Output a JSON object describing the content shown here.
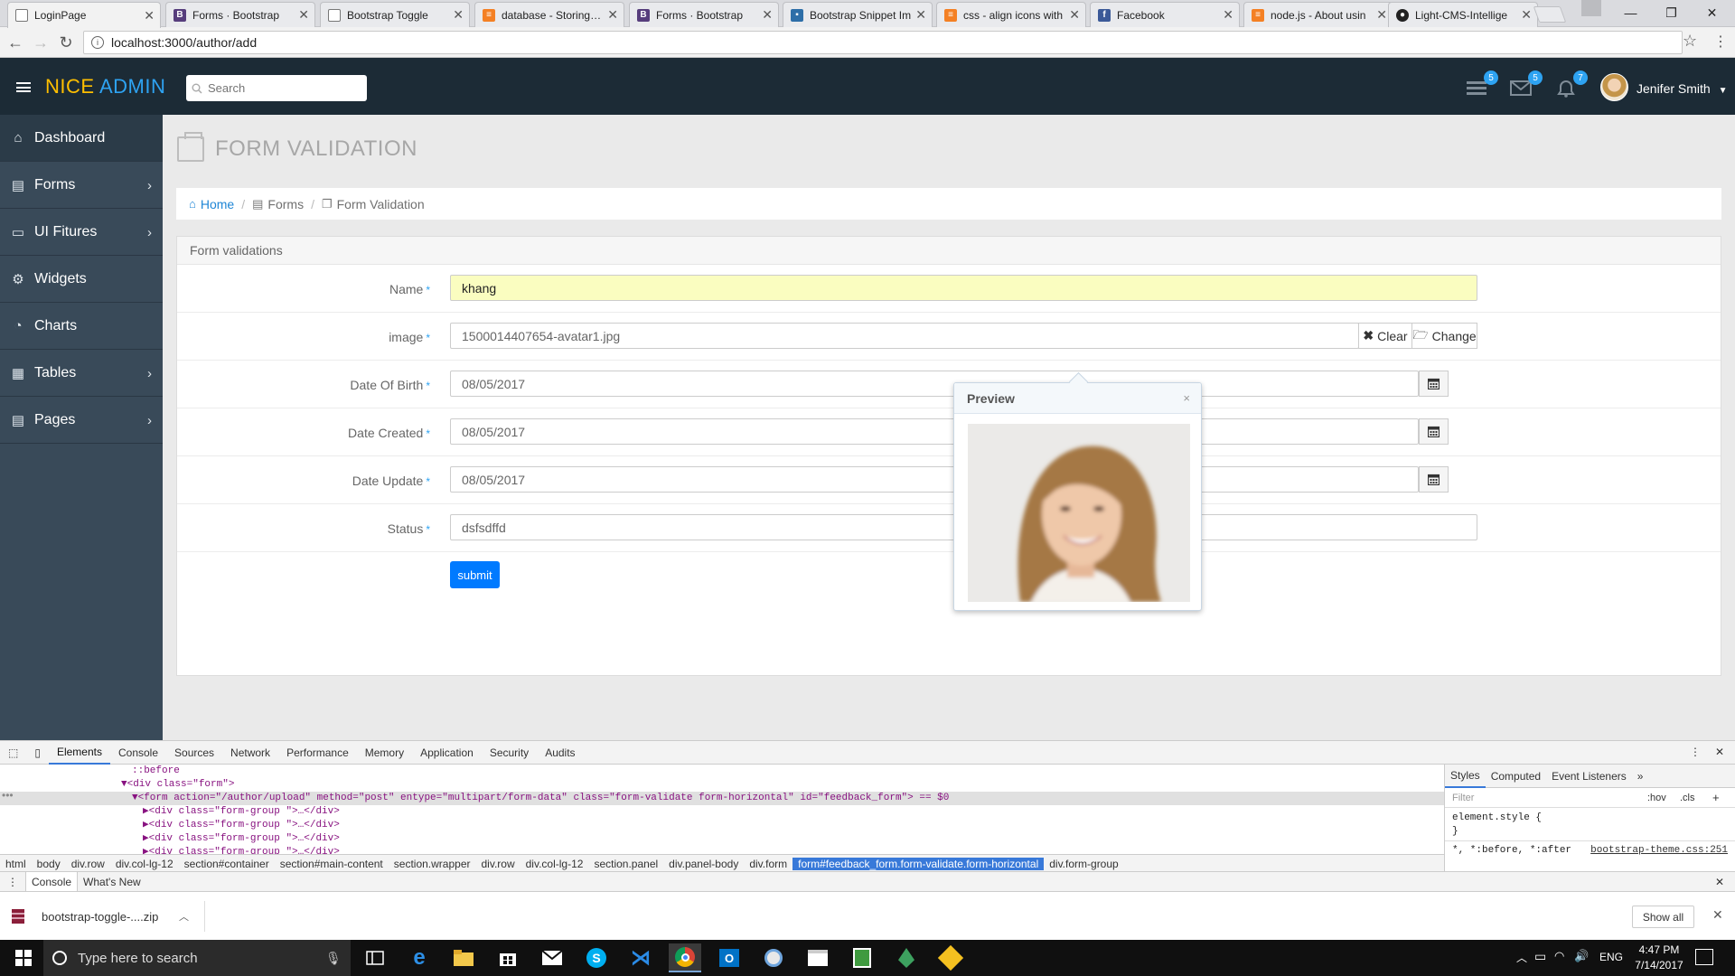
{
  "browser": {
    "tabs": [
      {
        "title": "LoginPage",
        "favicon": "page-icon",
        "active": true
      },
      {
        "title": "Forms · Bootstrap",
        "favicon": "bootstrap-icon"
      },
      {
        "title": "Bootstrap Toggle",
        "favicon": "page-icon"
      },
      {
        "title": "database - Storing im",
        "favicon": "stackoverflow-icon"
      },
      {
        "title": "Forms · Bootstrap",
        "favicon": "bootstrap-icon"
      },
      {
        "title": "Bootstrap Snippet Im",
        "favicon": "snippet-icon"
      },
      {
        "title": "css - align icons with",
        "favicon": "stackoverflow-icon"
      },
      {
        "title": "Facebook",
        "favicon": "facebook-icon"
      },
      {
        "title": "node.js - About usin",
        "favicon": "stackoverflow-icon"
      },
      {
        "title": "Light-CMS-Intellige",
        "favicon": "github-icon"
      }
    ],
    "url": "localhost:3000/author/add"
  },
  "app": {
    "brand_primary": "NICE",
    "brand_secondary": "ADMIN",
    "search_placeholder": "Search",
    "badges": {
      "tasks": "5",
      "mail": "5",
      "notifications": "7"
    },
    "user_name": "Jenifer Smith"
  },
  "sidebar": {
    "items": [
      {
        "label": "Dashboard",
        "icon": "home-icon",
        "has_submenu": false
      },
      {
        "label": "Forms",
        "icon": "document-icon",
        "has_submenu": true
      },
      {
        "label": "UI Fitures",
        "icon": "monitor-icon",
        "has_submenu": true
      },
      {
        "label": "Widgets",
        "icon": "cogs-icon",
        "has_submenu": false
      },
      {
        "label": "Charts",
        "icon": "pie-chart-icon",
        "has_submenu": false
      },
      {
        "label": "Tables",
        "icon": "table-icon",
        "has_submenu": true
      },
      {
        "label": "Pages",
        "icon": "pages-icon",
        "has_submenu": true
      }
    ]
  },
  "page": {
    "title": "FORM VALIDATION",
    "breadcrumb": [
      "Home",
      "Forms",
      "Form Validation"
    ]
  },
  "form": {
    "panel_title": "Form validations",
    "required_mark": "*",
    "fields": {
      "name": {
        "label": "Name",
        "value": "khang"
      },
      "image": {
        "label": "image",
        "value": "1500014407654-avatar1.jpg",
        "clear_label": "Clear",
        "change_label": "Change"
      },
      "dob": {
        "label": "Date Of Birth",
        "value": "08/05/2017"
      },
      "created": {
        "label": "Date Created",
        "value": "08/05/2017"
      },
      "updated": {
        "label": "Date Update",
        "value": "08/05/2017"
      },
      "status": {
        "label": "Status",
        "value": "dsfsdffd"
      }
    },
    "submit_label": "submit",
    "preview": {
      "title": "Preview",
      "close": "×"
    }
  },
  "devtools": {
    "tabs": [
      "Elements",
      "Console",
      "Sources",
      "Network",
      "Performance",
      "Memory",
      "Application",
      "Security",
      "Audits"
    ],
    "code_lines": [
      "::before",
      "▼<div class=\"form\">",
      "▼<form action=\"/author/upload\" method=\"post\" entype=\"multipart/form-data\" class=\"form-validate form-horizontal\" id=\"feedback_form\"> == $0",
      "▶<div class=\"form-group \">…</div>",
      "▶<div class=\"form-group \">…</div>",
      "▶<div class=\"form-group \">…</div>",
      "▶<div class=\"form-group \">…</div>"
    ],
    "path": [
      "html",
      "body",
      "div.row",
      "div.col-lg-12",
      "section#container",
      "section#main-content",
      "section.wrapper",
      "div.row",
      "div.col-lg-12",
      "section.panel",
      "div.panel-body",
      "div.form",
      "form#feedback_form.form-validate.form-horizontal",
      "div.form-group"
    ],
    "styles_tabs": [
      "Styles",
      "Computed",
      "Event Listeners"
    ],
    "filter_placeholder": "Filter",
    "hov": ":hov",
    "cls": ".cls",
    "element_style": "element.style {",
    "close_brace": "}",
    "rule_selector": "*, *:before, *:after",
    "rule_source": "bootstrap-theme.css:251",
    "drawer_tabs": [
      "Console",
      "What's New"
    ]
  },
  "downloads": {
    "file": "bootstrap-toggle-....zip",
    "show_all": "Show all"
  },
  "taskbar": {
    "search_placeholder": "Type here to search",
    "lang": "ENG",
    "time": "4:47 PM",
    "date": "7/14/2017"
  },
  "colors": {
    "header_bg": "#1c2b36",
    "sidebar_bg": "#394a59",
    "brand_yellow": "#ffbf00",
    "brand_blue": "#2ea3f2",
    "submit_blue": "#007aff",
    "autofill_yellow": "#fafdc0"
  }
}
